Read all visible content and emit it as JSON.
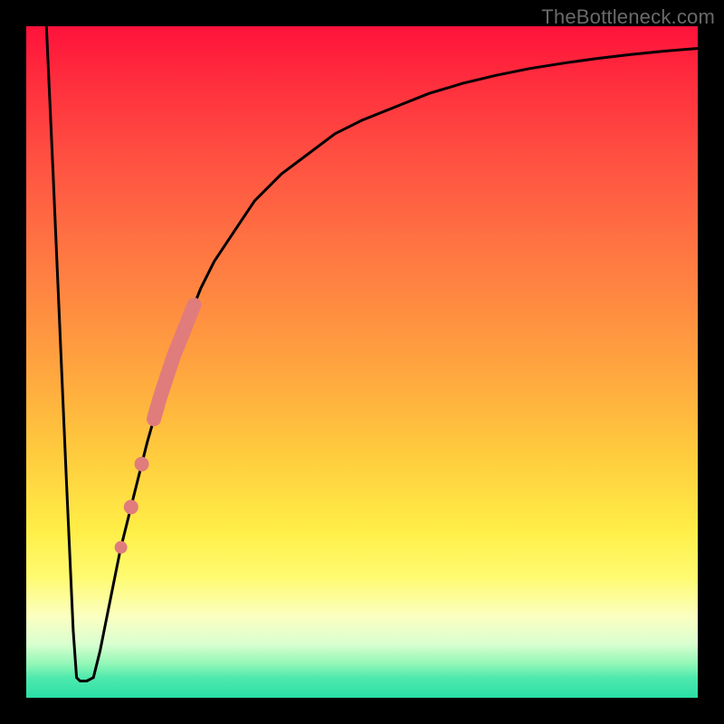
{
  "watermark": "TheBottleneck.com",
  "chart_data": {
    "type": "line",
    "title": "",
    "xlabel": "",
    "ylabel": "",
    "xlim": [
      0,
      100
    ],
    "ylim": [
      0,
      100
    ],
    "grid": false,
    "legend": false,
    "series": [
      {
        "name": "bottleneck-curve",
        "color": "#000000",
        "x": [
          3,
          4,
          5,
          6,
          7,
          7.5,
          8,
          9,
          10,
          11,
          12,
          14,
          16,
          18,
          20,
          22,
          24,
          26,
          28,
          30,
          34,
          38,
          42,
          46,
          50,
          55,
          60,
          65,
          70,
          75,
          80,
          85,
          90,
          95,
          100
        ],
        "y": [
          100,
          78,
          55,
          32,
          10,
          3,
          2.5,
          2.5,
          3,
          7,
          12,
          22,
          30,
          38,
          45,
          51,
          56,
          61,
          65,
          68,
          74,
          78,
          81,
          84,
          86,
          88,
          90,
          91.5,
          92.7,
          93.7,
          94.5,
          95.2,
          95.8,
          96.3,
          96.7
        ]
      }
    ],
    "highlight_band": {
      "name": "highlighted-segment",
      "color": "#e07c7c",
      "thick_range_x": [
        19,
        25
      ],
      "dots_x": [
        17.2,
        15.6,
        14.1
      ]
    }
  }
}
